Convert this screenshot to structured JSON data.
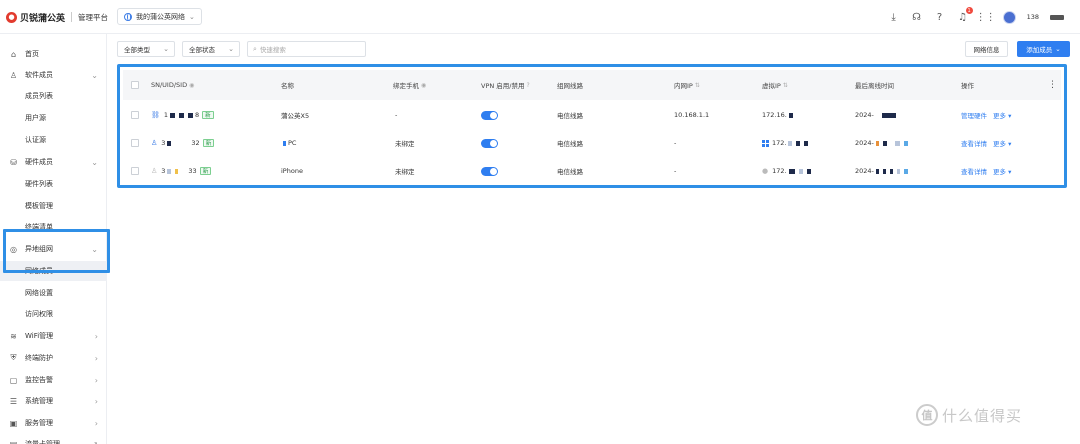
{
  "header": {
    "brand_name": "贝锐蒲公英",
    "brand_sub": "管理平台",
    "network_select": "我的蒲公英网络",
    "user_name": "138"
  },
  "sidebar": {
    "items": [
      {
        "label": "首页",
        "icon": "home-icon",
        "arrow": ""
      },
      {
        "label": "软件成员",
        "icon": "user-icon",
        "arrow": "⌄"
      },
      {
        "label": "成员列表",
        "icon": "",
        "arrow": ""
      },
      {
        "label": "用户源",
        "icon": "",
        "arrow": ""
      },
      {
        "label": "认证源",
        "icon": "",
        "arrow": ""
      },
      {
        "label": "硬件成员",
        "icon": "router-icon",
        "arrow": "⌄"
      },
      {
        "label": "硬件列表",
        "icon": "",
        "arrow": ""
      },
      {
        "label": "模板管理",
        "icon": "",
        "arrow": ""
      },
      {
        "label": "终端清单",
        "icon": "",
        "arrow": ""
      },
      {
        "label": "异地组网",
        "icon": "network-icon",
        "arrow": "⌄"
      },
      {
        "label": "网络成员",
        "icon": "",
        "arrow": ""
      },
      {
        "label": "网络设置",
        "icon": "",
        "arrow": ""
      },
      {
        "label": "访问权限",
        "icon": "",
        "arrow": ""
      },
      {
        "label": "WiFi管理",
        "icon": "wifi-icon",
        "arrow": "›"
      },
      {
        "label": "终端防护",
        "icon": "shield-icon",
        "arrow": "›"
      },
      {
        "label": "监控告警",
        "icon": "monitor-icon",
        "arrow": "›"
      },
      {
        "label": "系统管理",
        "icon": "settings-icon",
        "arrow": "›"
      },
      {
        "label": "服务管理",
        "icon": "service-icon",
        "arrow": "›"
      },
      {
        "label": "流量卡管理",
        "icon": "simcard-icon",
        "arrow": "↗"
      }
    ]
  },
  "toolbar": {
    "filter_type": "全部类型",
    "filter_status": "全部状态",
    "search_placeholder": "快速搜索",
    "network_info": "网络信息",
    "add_member": "添加成员"
  },
  "table": {
    "columns": [
      "SN/UID/SID",
      "名称",
      "绑定手机",
      "VPN 启用/禁用",
      "组网线路",
      "内网IP",
      "虚拟IP",
      "最后离线时间",
      "操作"
    ],
    "rows": [
      {
        "sn_prefix": "1",
        "sn_suffix": "8",
        "tag": "新",
        "name": "蒲公英X5",
        "phone": "-",
        "vpn_on": true,
        "line": "电信线路",
        "lan_ip": "10.168.1.1",
        "vip": "172.16.",
        "time": "2024-",
        "action1": "管理硬件",
        "action2": "更多"
      },
      {
        "sn_prefix": "3",
        "sn_suffix": "32",
        "tag": "新",
        "name": "PC",
        "phone": "未绑定",
        "vpn_on": true,
        "line": "电信线路",
        "lan_ip": "-",
        "vip": "172.",
        "time": "2024-",
        "action1": "查看详情",
        "action2": "更多"
      },
      {
        "sn_prefix": "3",
        "sn_suffix": "33",
        "tag": "新",
        "name": "iPhone",
        "phone": "未绑定",
        "vpn_on": true,
        "line": "电信线路",
        "lan_ip": "-",
        "vip": "172.",
        "time": "2024-",
        "action1": "查看详情",
        "action2": "更多"
      }
    ]
  },
  "watermark": {
    "symbol": "值",
    "text": "什么值得买"
  },
  "colors": {
    "accent": "#2f7ef0",
    "highlight_border": "#2f8fe6",
    "brand_red": "#e23b2e"
  }
}
